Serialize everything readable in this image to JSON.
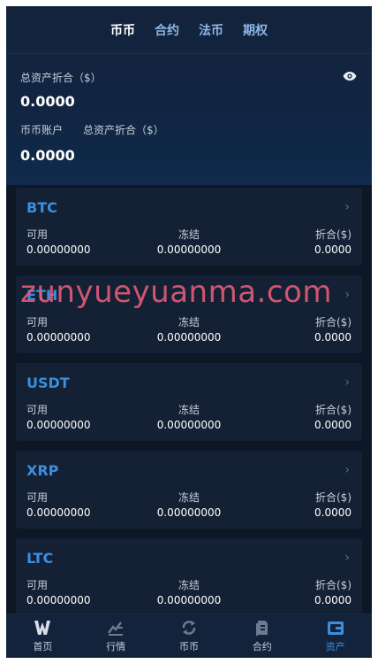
{
  "tabs": [
    "币币",
    "合约",
    "法币",
    "期权"
  ],
  "summary": {
    "total_label": "总资产折合（$）",
    "total_value": "0.0000",
    "account_label": "币币账户",
    "account_total_label": "总资产折合（$）",
    "account_value": "0.0000"
  },
  "columns": {
    "available": "可用",
    "frozen": "冻结",
    "converted": "折合($)"
  },
  "coins": [
    {
      "name": "BTC",
      "available": "0.00000000",
      "frozen": "0.00000000",
      "converted": "0.0000"
    },
    {
      "name": "ETH",
      "available": "0.00000000",
      "frozen": "0.00000000",
      "converted": "0.0000"
    },
    {
      "name": "USDT",
      "available": "0.00000000",
      "frozen": "0.00000000",
      "converted": "0.0000"
    },
    {
      "name": "XRP",
      "available": "0.00000000",
      "frozen": "0.00000000",
      "converted": "0.0000"
    },
    {
      "name": "LTC",
      "available": "0.00000000",
      "frozen": "0.00000000",
      "converted": "0.0000"
    }
  ],
  "nav": [
    {
      "label": "首页",
      "icon": "home-logo-icon"
    },
    {
      "label": "行情",
      "icon": "market-icon"
    },
    {
      "label": "币币",
      "icon": "exchange-icon"
    },
    {
      "label": "合约",
      "icon": "contract-icon"
    },
    {
      "label": "资产",
      "icon": "wallet-icon"
    }
  ],
  "watermark": "zunyueyuanma.com",
  "colors": {
    "accent": "#3b8fe0",
    "background": "#0d1725",
    "card": "#142033",
    "watermark": "#e45b78"
  }
}
